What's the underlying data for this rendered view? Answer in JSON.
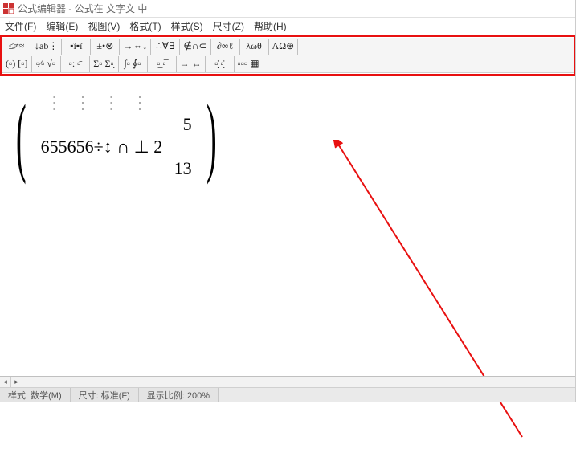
{
  "title": "公式编辑器 - 公式在 文字文 中",
  "menu": [
    "文件(F)",
    "编辑(E)",
    "视图(V)",
    "格式(T)",
    "样式(S)",
    "尺寸(Z)",
    "帮助(H)"
  ],
  "toolbar_row1": [
    "≤≠≈",
    "↓ab⋮",
    "▪ĩ▪ĩ",
    "±•⊗",
    "→⇔↓",
    "∴∀∃",
    "∉∩⊂",
    "∂∞ℓ",
    "λωθ",
    "ΛΩ⊛"
  ],
  "toolbar_row2": [
    "(▫) [▫]",
    "▫⁄▫ √▫",
    "▫: ▫̄",
    "Σ▫ Σ▫̣",
    "∫▫ ∮▫",
    "▫̲ ▫̅",
    "→ ↔",
    "▫̣̇ ▫̣̇",
    "▫▫▫ ▦"
  ],
  "formula": {
    "row1_right": "5",
    "row2_expr": "655656÷↕ ∩ ⊥ 2",
    "row3_right": "13"
  },
  "status": {
    "style_label": "样式: 数学(M)",
    "size_label": "尺寸: 标准(F)",
    "zoom_label": "显示比例: 200%"
  },
  "annotation_color": "#e81010"
}
